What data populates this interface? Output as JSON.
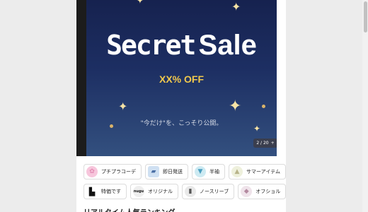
{
  "banner": {
    "title_part1": "Secret",
    "title_part2": "Sale",
    "discount": "XX% OFF",
    "subtext": "\"今だけ\"を、こっそり公開。",
    "pager_text": "2 / 20",
    "pager_next": "+"
  },
  "categories_row1": [
    {
      "label": "プチプラコーデ",
      "icon": "pink-circle-icon",
      "color": "#f7c6dc"
    },
    {
      "label": "即日発送",
      "icon": "truck-icon",
      "color": "#cfe0f2"
    },
    {
      "label": "半袖",
      "icon": "tshirt-icon",
      "color": "#cdeaf2"
    },
    {
      "label": "サマーアイテム",
      "icon": "summer-item-icon",
      "color": "#eef0dc"
    },
    {
      "label": "",
      "icon": "black-item-icon",
      "color": "#e6e6e6"
    }
  ],
  "categories_row2": [
    {
      "label": "特価です",
      "icon": "price-tag-icon",
      "color": "#ffffff"
    },
    {
      "label": "オリジナル",
      "icon": "nugu-logo-icon",
      "color": "#eeeeee",
      "icon_text": "nugu"
    },
    {
      "label": "ノースリーブ",
      "icon": "sleeveless-icon",
      "color": "#e9e9e9"
    },
    {
      "label": "オフショル",
      "icon": "off-shoulder-icon",
      "color": "#efe3ea"
    },
    {
      "label": "",
      "icon": "white-item-icon",
      "color": "#eef2ee"
    }
  ],
  "section": {
    "title": "リアルタイム人気ランキング"
  }
}
